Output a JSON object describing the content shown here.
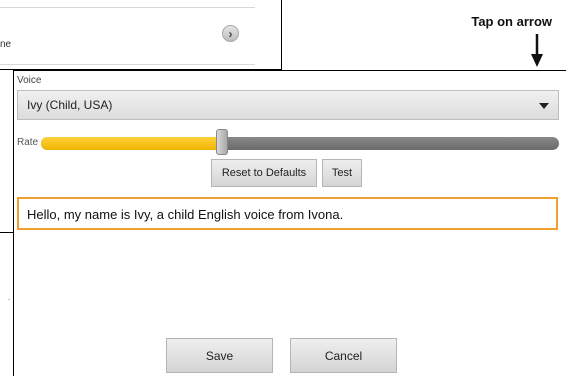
{
  "background": {
    "row_text": "ne",
    "dot_text": "."
  },
  "annotation": {
    "text": "Tap on arrow"
  },
  "dialog": {
    "voice_label": "Voice",
    "voice_value": "Ivy (Child, USA)",
    "rate_label": "Rate",
    "rate_level_percent": 35,
    "reset_label": "Reset to Defaults",
    "test_label": "Test",
    "sample_text": "Hello, my name is Ivy, a child English voice from Ivona.",
    "save_label": "Save",
    "cancel_label": "Cancel"
  },
  "colors": {
    "accent": "#f2b400",
    "input_border": "#f0a030"
  },
  "icons": {
    "voice_dropdown": "caret-down-icon",
    "background_row": "chevron-right-icon",
    "annotation": "arrow-down-icon"
  }
}
